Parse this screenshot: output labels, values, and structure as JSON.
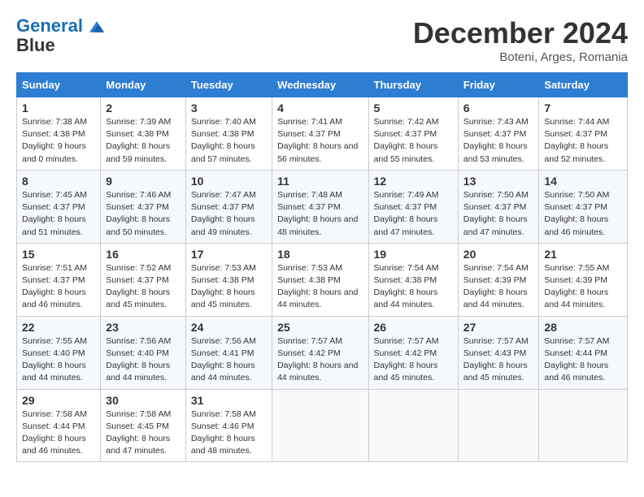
{
  "header": {
    "logo_line1": "General",
    "logo_line2": "Blue",
    "month": "December 2024",
    "location": "Boteni, Arges, Romania"
  },
  "weekdays": [
    "Sunday",
    "Monday",
    "Tuesday",
    "Wednesday",
    "Thursday",
    "Friday",
    "Saturday"
  ],
  "weeks": [
    [
      {
        "day": "1",
        "sunrise": "7:38 AM",
        "sunset": "4:38 PM",
        "daylight": "9 hours and 0 minutes."
      },
      {
        "day": "2",
        "sunrise": "7:39 AM",
        "sunset": "4:38 PM",
        "daylight": "8 hours and 59 minutes."
      },
      {
        "day": "3",
        "sunrise": "7:40 AM",
        "sunset": "4:38 PM",
        "daylight": "8 hours and 57 minutes."
      },
      {
        "day": "4",
        "sunrise": "7:41 AM",
        "sunset": "4:37 PM",
        "daylight": "8 hours and 56 minutes."
      },
      {
        "day": "5",
        "sunrise": "7:42 AM",
        "sunset": "4:37 PM",
        "daylight": "8 hours and 55 minutes."
      },
      {
        "day": "6",
        "sunrise": "7:43 AM",
        "sunset": "4:37 PM",
        "daylight": "8 hours and 53 minutes."
      },
      {
        "day": "7",
        "sunrise": "7:44 AM",
        "sunset": "4:37 PM",
        "daylight": "8 hours and 52 minutes."
      }
    ],
    [
      {
        "day": "8",
        "sunrise": "7:45 AM",
        "sunset": "4:37 PM",
        "daylight": "8 hours and 51 minutes."
      },
      {
        "day": "9",
        "sunrise": "7:46 AM",
        "sunset": "4:37 PM",
        "daylight": "8 hours and 50 minutes."
      },
      {
        "day": "10",
        "sunrise": "7:47 AM",
        "sunset": "4:37 PM",
        "daylight": "8 hours and 49 minutes."
      },
      {
        "day": "11",
        "sunrise": "7:48 AM",
        "sunset": "4:37 PM",
        "daylight": "8 hours and 48 minutes."
      },
      {
        "day": "12",
        "sunrise": "7:49 AM",
        "sunset": "4:37 PM",
        "daylight": "8 hours and 47 minutes."
      },
      {
        "day": "13",
        "sunrise": "7:50 AM",
        "sunset": "4:37 PM",
        "daylight": "8 hours and 47 minutes."
      },
      {
        "day": "14",
        "sunrise": "7:50 AM",
        "sunset": "4:37 PM",
        "daylight": "8 hours and 46 minutes."
      }
    ],
    [
      {
        "day": "15",
        "sunrise": "7:51 AM",
        "sunset": "4:37 PM",
        "daylight": "8 hours and 46 minutes."
      },
      {
        "day": "16",
        "sunrise": "7:52 AM",
        "sunset": "4:37 PM",
        "daylight": "8 hours and 45 minutes."
      },
      {
        "day": "17",
        "sunrise": "7:53 AM",
        "sunset": "4:38 PM",
        "daylight": "8 hours and 45 minutes."
      },
      {
        "day": "18",
        "sunrise": "7:53 AM",
        "sunset": "4:38 PM",
        "daylight": "8 hours and 44 minutes."
      },
      {
        "day": "19",
        "sunrise": "7:54 AM",
        "sunset": "4:38 PM",
        "daylight": "8 hours and 44 minutes."
      },
      {
        "day": "20",
        "sunrise": "7:54 AM",
        "sunset": "4:39 PM",
        "daylight": "8 hours and 44 minutes."
      },
      {
        "day": "21",
        "sunrise": "7:55 AM",
        "sunset": "4:39 PM",
        "daylight": "8 hours and 44 minutes."
      }
    ],
    [
      {
        "day": "22",
        "sunrise": "7:55 AM",
        "sunset": "4:40 PM",
        "daylight": "8 hours and 44 minutes."
      },
      {
        "day": "23",
        "sunrise": "7:56 AM",
        "sunset": "4:40 PM",
        "daylight": "8 hours and 44 minutes."
      },
      {
        "day": "24",
        "sunrise": "7:56 AM",
        "sunset": "4:41 PM",
        "daylight": "8 hours and 44 minutes."
      },
      {
        "day": "25",
        "sunrise": "7:57 AM",
        "sunset": "4:42 PM",
        "daylight": "8 hours and 44 minutes."
      },
      {
        "day": "26",
        "sunrise": "7:57 AM",
        "sunset": "4:42 PM",
        "daylight": "8 hours and 45 minutes."
      },
      {
        "day": "27",
        "sunrise": "7:57 AM",
        "sunset": "4:43 PM",
        "daylight": "8 hours and 45 minutes."
      },
      {
        "day": "28",
        "sunrise": "7:57 AM",
        "sunset": "4:44 PM",
        "daylight": "8 hours and 46 minutes."
      }
    ],
    [
      {
        "day": "29",
        "sunrise": "7:58 AM",
        "sunset": "4:44 PM",
        "daylight": "8 hours and 46 minutes."
      },
      {
        "day": "30",
        "sunrise": "7:58 AM",
        "sunset": "4:45 PM",
        "daylight": "8 hours and 47 minutes."
      },
      {
        "day": "31",
        "sunrise": "7:58 AM",
        "sunset": "4:46 PM",
        "daylight": "8 hours and 48 minutes."
      },
      null,
      null,
      null,
      null
    ]
  ]
}
